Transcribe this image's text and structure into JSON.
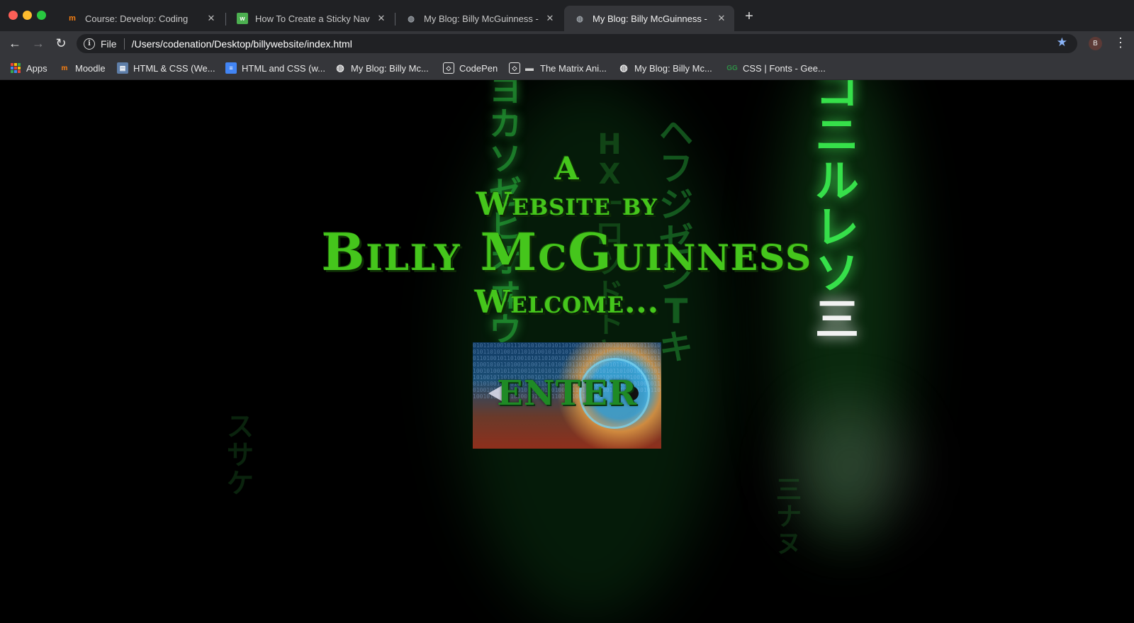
{
  "window": {
    "tabs": [
      {
        "title": "Course: Develop: Coding",
        "icon": "moodle-icon",
        "active": false
      },
      {
        "title": "How To Create a Sticky Navbar",
        "icon": "w3schools-icon",
        "active": false
      },
      {
        "title": "My Blog: Billy McGuinness - De",
        "icon": "globe-icon",
        "active": false
      },
      {
        "title": "My Blog: Billy McGuinness - De",
        "icon": "globe-icon",
        "active": true
      }
    ],
    "new_tab_label": "+"
  },
  "toolbar": {
    "back": "←",
    "forward": "→",
    "reload": "↻",
    "scheme": "File",
    "url": "/Users/codenation/Desktop/billywebsite/index.html",
    "star": "★",
    "avatar_letter": "B",
    "menu": "⋮"
  },
  "bookmarks": [
    {
      "label": "Apps",
      "icon": "apps-grid-icon"
    },
    {
      "label": "Moodle",
      "icon": "moodle-icon"
    },
    {
      "label": "HTML & CSS (We...",
      "icon": "book-icon"
    },
    {
      "label": "HTML and CSS (w...",
      "icon": "google-docs-icon"
    },
    {
      "label": "My Blog: Billy Mc...",
      "icon": "globe-icon"
    },
    {
      "label": "CodePen",
      "icon": "codepen-icon"
    },
    {
      "label": "The Matrix Ani...",
      "icon": "codepen-icon"
    },
    {
      "label": "My Blog: Billy Mc...",
      "icon": "globe-icon"
    },
    {
      "label": "CSS | Fonts - Gee...",
      "icon": "geeksforgeeks-icon"
    }
  ],
  "page": {
    "line_a": "A",
    "line_by": "Website by",
    "name": "Billy McGuinness",
    "welcome": "Welcome...",
    "enter_label": "ENTER"
  },
  "colors": {
    "accent_green": "#45c61c",
    "tab_bar": "#202124",
    "toolbar": "#35363a",
    "star": "#8ab4f8"
  }
}
